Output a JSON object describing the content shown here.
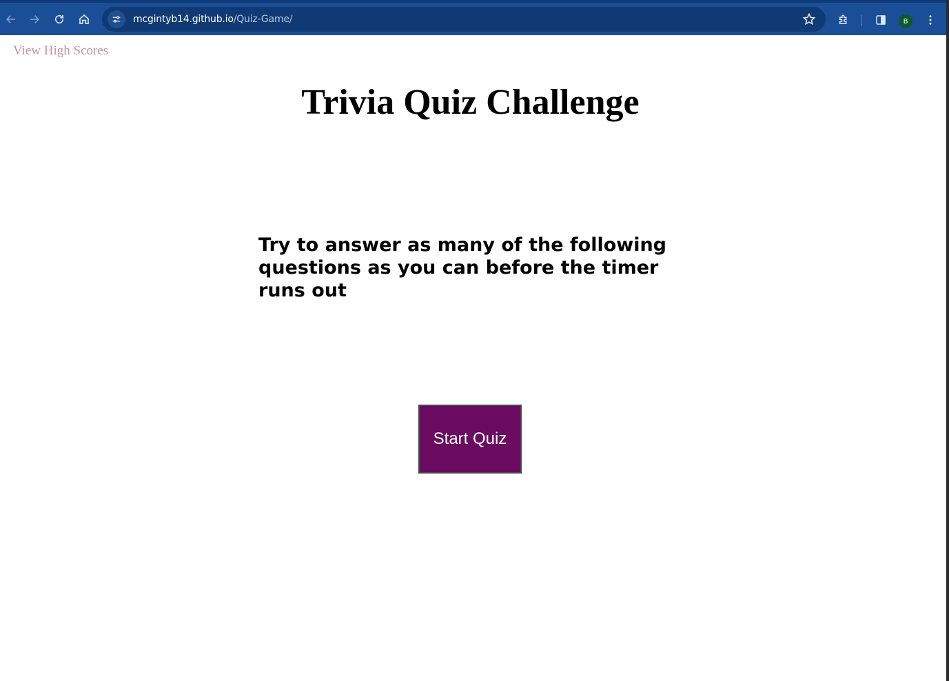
{
  "browser": {
    "url_host": "mcgintyb14.github.io",
    "url_path": "/Quiz-Game/",
    "profile_initial": "B",
    "icons": [
      "back-icon",
      "forward-icon",
      "reload-icon",
      "home-icon",
      "site-info-icon",
      "bookmark-star-icon",
      "extensions-icon",
      "side-panel-icon",
      "menu-icon"
    ],
    "colors": {
      "toolbar": "#1a4e96",
      "omnibox": "#0f3a74",
      "avatar": "#0e5a2e"
    }
  },
  "page": {
    "highscores_link": "View High Scores",
    "title": "Trivia Quiz Challenge",
    "instructions": "Try to answer as many of the following questions as you can before the timer runs out",
    "start_button": "Start Quiz",
    "colors": {
      "start_button": "#6a0a61",
      "link": "#c8909c"
    }
  }
}
